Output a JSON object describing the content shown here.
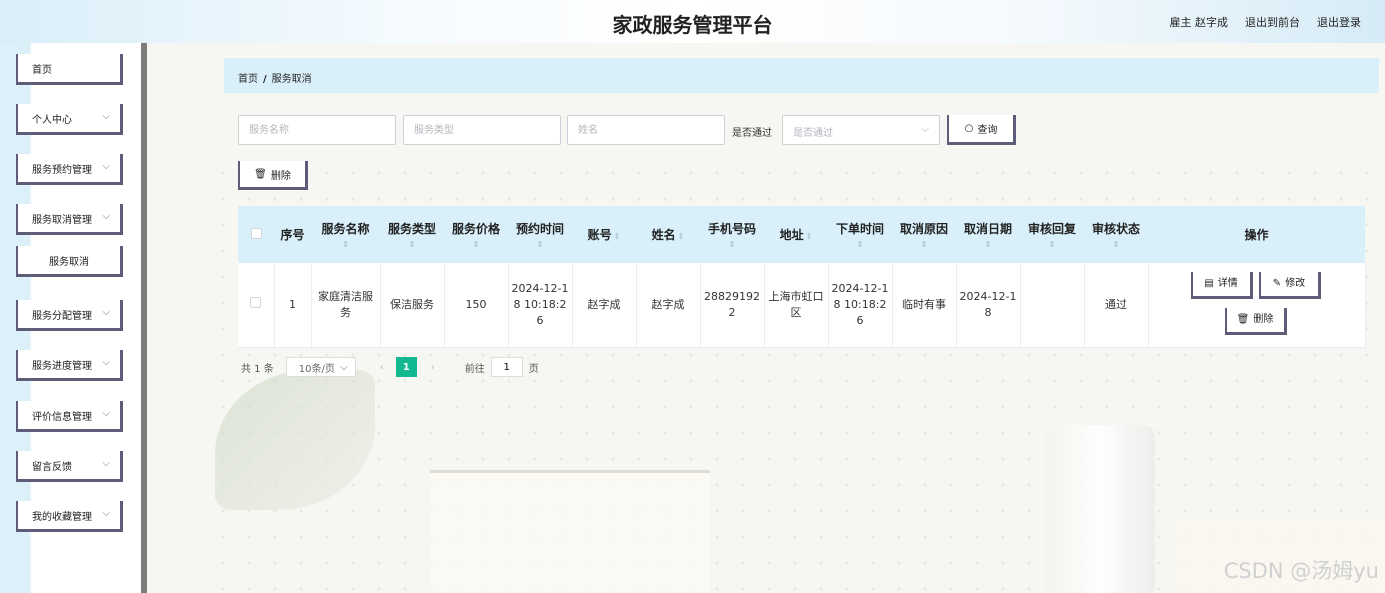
{
  "header": {
    "title": "家政服务管理平台",
    "user": "雇主 赵字成",
    "to_front": "退出到前台",
    "logout": "退出登录"
  },
  "sidebar": {
    "items": [
      {
        "label": "首页"
      },
      {
        "label": "个人中心"
      },
      {
        "label": "服务预约管理"
      },
      {
        "label": "服务取消管理"
      },
      {
        "label": "服务取消"
      },
      {
        "label": "服务分配管理"
      },
      {
        "label": "服务进度管理"
      },
      {
        "label": "评价信息管理"
      },
      {
        "label": "留言反馈"
      },
      {
        "label": "我的收藏管理"
      }
    ]
  },
  "breadcrumb": {
    "home": "首页",
    "separator": "/",
    "current": "服务取消"
  },
  "search": {
    "service_name_placeholder": "服务名称",
    "service_type_placeholder": "服务类型",
    "name_placeholder": "姓名",
    "pass_label": "是否通过",
    "pass_placeholder": "是否通过",
    "search_button": "查询"
  },
  "toolbar": {
    "delete_button": "删除"
  },
  "table": {
    "headers": {
      "index": "序号",
      "service_name": "服务名称",
      "service_type": "服务类型",
      "service_price": "服务价格",
      "booking_time": "预约时间",
      "account": "账号",
      "name": "姓名",
      "phone": "手机号码",
      "address": "地址",
      "order_time": "下单时间",
      "cancel_reason": "取消原因",
      "cancel_date": "取消日期",
      "review_reply": "审核回复",
      "review_status": "审核状态",
      "actions": "操作"
    },
    "rows": [
      {
        "index": "1",
        "service_name": "家庭清洁服务",
        "service_type": "保洁服务",
        "service_price": "150",
        "booking_time": "2024-12-18 10:18:26",
        "account": "赵字成",
        "name": "赵字成",
        "phone": "288291922",
        "address": "上海市虹口区",
        "order_time": "2024-12-18 10:18:26",
        "cancel_reason": "临时有事",
        "cancel_date": "2024-12-18",
        "review_reply": "",
        "review_status": "通过"
      }
    ],
    "row_actions": {
      "detail": "详情",
      "edit": "修改",
      "delete": "删除"
    }
  },
  "pagination": {
    "total": "共 1 条",
    "page_size": "10条/页",
    "current_page": "1",
    "goto_label": "前往",
    "goto_value": "1",
    "page_label": "页"
  },
  "watermark": "CSDN @汤姆yu",
  "colors": {
    "accent": "#12b88f",
    "header_bg": "#d9f0fb",
    "button_border": "#5d5d7a"
  }
}
